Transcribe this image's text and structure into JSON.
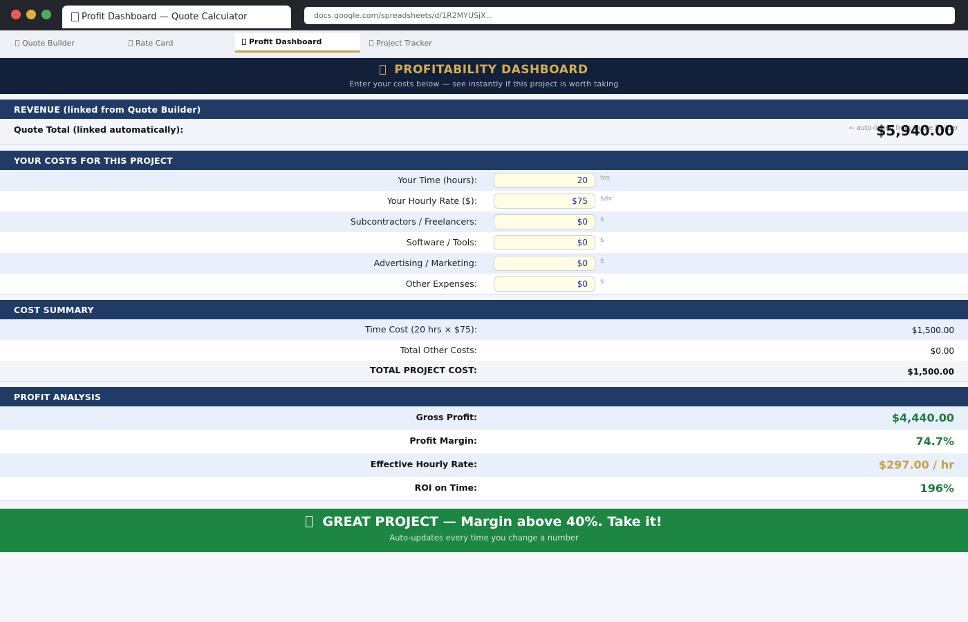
{
  "browser": {
    "tab_title": "Profit Dashboard — Quote Calculator",
    "url": "docs.google.com/spreadsheets/d/1R2MYUSjX..."
  },
  "sheet_tabs": [
    {
      "label": "Quote Builder",
      "active": false
    },
    {
      "label": "Rate Card",
      "active": false
    },
    {
      "label": "Profit Dashboard",
      "active": true
    },
    {
      "label": "Project Tracker",
      "active": false
    }
  ],
  "header": {
    "title": "PROFITABILITY DASHBOARD",
    "subtitle": "Enter your costs below — see instantly if this project is worth taking"
  },
  "revenue": {
    "section_title": "REVENUE (linked from Quote Builder)",
    "label": "Quote Total (linked automatically):",
    "note": "← auto-linked from Quote Builder",
    "value": "$5,940.00"
  },
  "costs": {
    "section_title": "YOUR COSTS FOR THIS PROJECT",
    "rows": [
      {
        "label": "Your Time (hours):",
        "value": "20",
        "unit": "hrs"
      },
      {
        "label": "Your Hourly Rate ($):",
        "value": "$75",
        "unit": "$/hr"
      },
      {
        "label": "Subcontractors / Freelancers:",
        "value": "$0",
        "unit": "$"
      },
      {
        "label": "Software / Tools:",
        "value": "$0",
        "unit": "$"
      },
      {
        "label": "Advertising / Marketing:",
        "value": "$0",
        "unit": "$"
      },
      {
        "label": "Other Expenses:",
        "value": "$0",
        "unit": "$"
      }
    ]
  },
  "summary": {
    "section_title": "COST SUMMARY",
    "rows": [
      {
        "label": "Time Cost (20 hrs × $75):",
        "value": "$1,500.00"
      },
      {
        "label": "Total Other Costs:",
        "value": "$0.00"
      },
      {
        "label": "TOTAL PROJECT COST:",
        "value": "$1,500.00"
      }
    ]
  },
  "profit": {
    "section_title": "PROFIT ANALYSIS",
    "rows": [
      {
        "label": "Gross Profit:",
        "value": "$4,440.00",
        "color": "#1f7a3f"
      },
      {
        "label": "Profit Margin:",
        "value": "74.7%",
        "color": "#1f7a3f"
      },
      {
        "label": "Effective Hourly Rate:",
        "value": "$297.00 / hr",
        "color": "#c9a046"
      },
      {
        "label": "ROI on Time:",
        "value": "196%",
        "color": "#1f7a3f"
      }
    ]
  },
  "verdict": {
    "title": "GREAT PROJECT — Margin above 40%. Take it!",
    "subtitle": "Auto-updates every time you change a number",
    "color": "#1e8643"
  }
}
